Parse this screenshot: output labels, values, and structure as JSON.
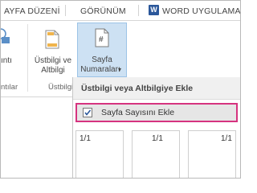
{
  "tabs": {
    "layout_label": "AYFA DÜZENİ",
    "view_label": "GÖRÜNÜM",
    "word_icon_letter": "W",
    "word_apps_label": "WORD UYGULAMASI"
  },
  "ribbon": {
    "partial_left_label": "ıntı",
    "partial_left_group_label": "ntılar",
    "header_footer_line1": "Üstbilgi ve",
    "header_footer_line2": "Altbilgi",
    "page_numbers_line1": "Sayfa",
    "page_numbers_line2": "Numaraları",
    "page_numbers_caret": "▾",
    "group_label": "Üstbilgi"
  },
  "dropdown": {
    "title": "Üstbilgi veya Altbilgiye Ekle",
    "item_label": "Sayfa Sayısını Ekle",
    "checked": true,
    "thumbnails": [
      "1/1",
      "1/1",
      "1/1"
    ]
  },
  "colors": {
    "selection_outline": "#d6337f",
    "button_highlight": "#cde1f3",
    "word_blue": "#2b579a"
  }
}
